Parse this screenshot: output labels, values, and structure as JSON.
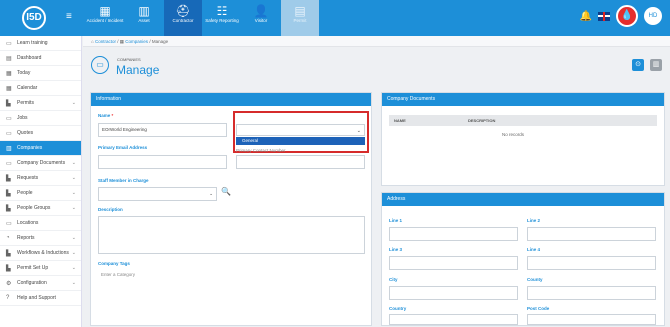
{
  "app": {
    "logo": "I5D"
  },
  "modules": [
    {
      "label": "Accident / Incident",
      "icon": "accident-icon",
      "glyph": "▦"
    },
    {
      "label": "Asset",
      "icon": "asset-icon",
      "glyph": "▥"
    },
    {
      "label": "Contractor",
      "icon": "contractor-icon",
      "glyph": "⛑"
    },
    {
      "label": "Safety Reporting",
      "icon": "safety-reporting-icon",
      "glyph": "☷"
    },
    {
      "label": "Visitor",
      "icon": "visitor-icon",
      "glyph": "👤"
    },
    {
      "label": "Permit",
      "icon": "permit-icon",
      "glyph": "▤"
    }
  ],
  "topbar": {
    "avatar_initials": "HD"
  },
  "sidebar": {
    "items": [
      {
        "label": "Learn training",
        "icon": "learn-icon",
        "glyph": "▭"
      },
      {
        "label": "Dashboard",
        "icon": "dashboard-icon",
        "glyph": "▤"
      },
      {
        "label": "Today",
        "icon": "today-icon",
        "glyph": "▦"
      },
      {
        "label": "Calendar",
        "icon": "calendar-icon",
        "glyph": "▦"
      },
      {
        "label": "Permits",
        "icon": "permits-icon",
        "glyph": "▙",
        "chevron": true
      },
      {
        "label": "Jobs",
        "icon": "jobs-icon",
        "glyph": "▭"
      },
      {
        "label": "Quotes",
        "icon": "quotes-icon",
        "glyph": "▭"
      },
      {
        "label": "Companies",
        "icon": "companies-icon",
        "glyph": "▥",
        "active": true
      },
      {
        "label": "Company Documents",
        "icon": "company-documents-icon",
        "glyph": "▭",
        "chevron": true
      },
      {
        "label": "Requests",
        "icon": "requests-icon",
        "glyph": "▙",
        "chevron": true
      },
      {
        "label": "People",
        "icon": "people-icon",
        "glyph": "▙",
        "chevron": true
      },
      {
        "label": "People Groups",
        "icon": "people-groups-icon",
        "glyph": "▙",
        "chevron": true
      },
      {
        "label": "Locations",
        "icon": "locations-icon",
        "glyph": "▭"
      },
      {
        "label": "Reports",
        "icon": "reports-icon",
        "glyph": "◔",
        "chevron": true
      },
      {
        "label": "Workflows & Inductions",
        "icon": "workflows-icon",
        "glyph": "▙",
        "chevron": true
      },
      {
        "label": "Permit Set Up",
        "icon": "permit-setup-icon",
        "glyph": "▙",
        "chevron": true
      },
      {
        "label": "Configuration",
        "icon": "configuration-icon",
        "glyph": "⚙",
        "chevron": true
      },
      {
        "label": "Help and Support",
        "icon": "help-icon",
        "glyph": "?"
      }
    ]
  },
  "breadcrumb": {
    "items": [
      "Contractor",
      "Companies",
      "Manage"
    ]
  },
  "header": {
    "subtitle": "COMPANIES",
    "title": "Manage"
  },
  "information": {
    "title": "Information",
    "name_label": "Name",
    "name_value": "EOrWorld Engineering",
    "company_type_label": "Company Type",
    "company_type_option": "General",
    "email_label": "Primary Email Address",
    "phone_label": "Primary Contact Number",
    "staff_label": "Staff Member in Charge",
    "description_label": "Description",
    "tags_label": "Company Tags",
    "tags_placeholder": "Enter a Category"
  },
  "documents": {
    "title": "Company Documents",
    "col_name": "NAME",
    "col_description": "DESCRIPTION",
    "empty": "No records"
  },
  "address": {
    "title": "Address",
    "line1": "Line 1",
    "line2": "Line 2",
    "line3": "Line 3",
    "line4": "Line 4",
    "city": "City",
    "county": "County",
    "country": "Country",
    "postcode": "Post Code"
  },
  "colors": {
    "primary": "#1d8fd8",
    "dark": "#1769b8",
    "danger": "#d62b2b",
    "selected": "#1d62b8"
  }
}
